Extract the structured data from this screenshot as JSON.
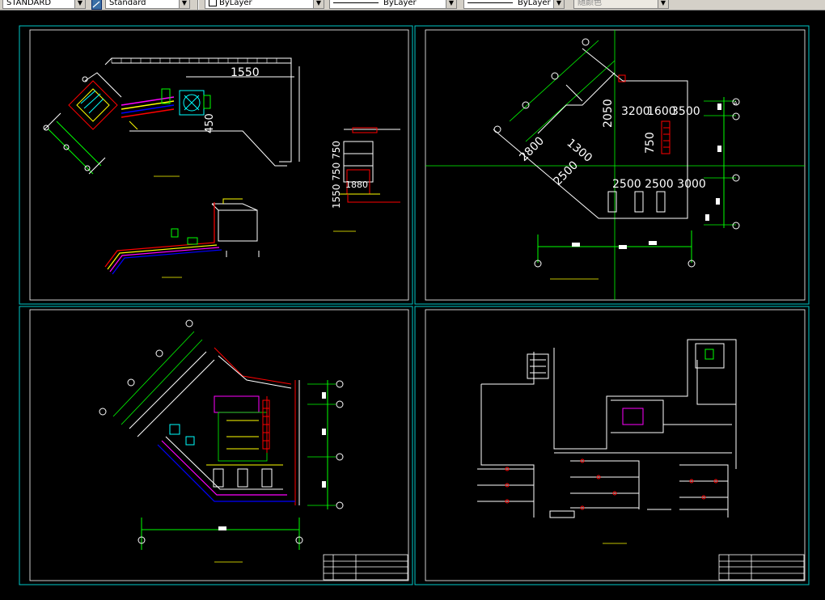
{
  "toolbar": {
    "textstyle_value": "STANDARD",
    "dimstyle_value": "Standard",
    "layer_value": "ByLayer",
    "linetype_value": "ByLayer",
    "lineweight_value": "ByLayer",
    "plotstyle_value": "随颜色"
  },
  "drawing": {
    "frame_color": "#00c8c8",
    "dim_color": "#00ff00",
    "top_left": {
      "dim_1550_top": "1550",
      "dim_450": "450",
      "detail_dims": "1550 750 750",
      "detail_dim2": "1880"
    },
    "top_right": {
      "dim_3200": "3200",
      "dim_1600": "1600",
      "dim_3500": "3500",
      "dim_2050": "2050",
      "dim_1300": "1300",
      "dim_2800": "2800",
      "dim_2500a": "2500",
      "dim_750": "750",
      "dim_row": "2500 2500 3000"
    },
    "axis_label_a": "A"
  }
}
